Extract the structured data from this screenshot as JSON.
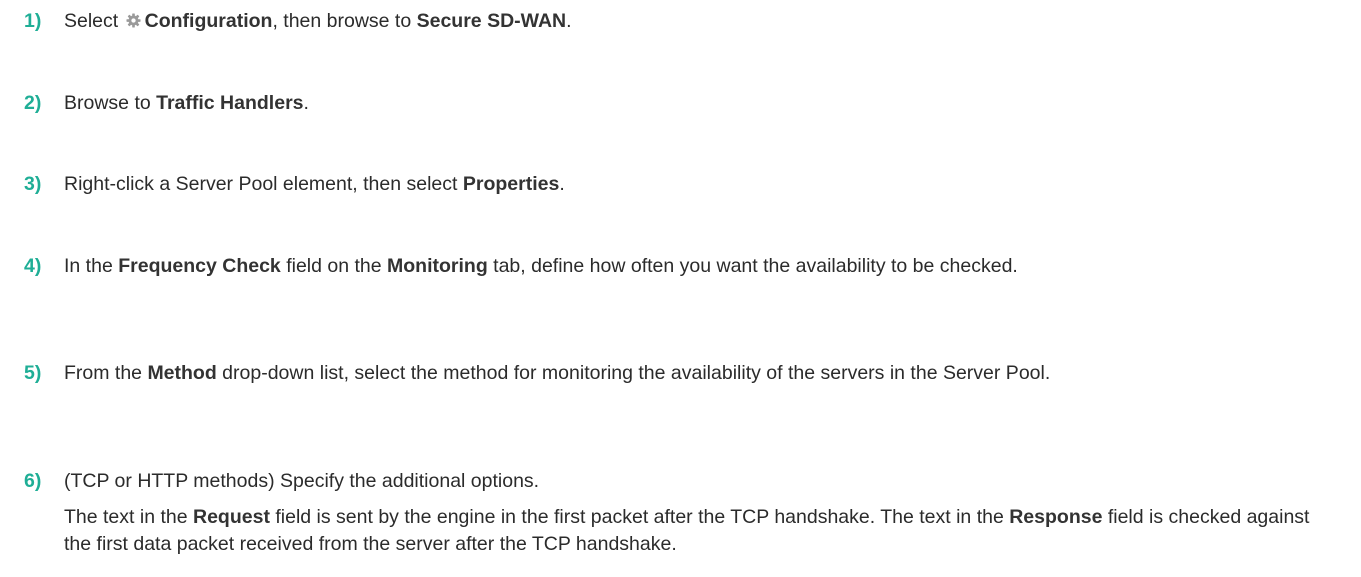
{
  "steps": [
    {
      "number": "1)",
      "parts": [
        {
          "t": "Select "
        },
        {
          "icon": "gear-icon"
        },
        {
          "t": "Configuration",
          "b": true
        },
        {
          "t": ", then browse to "
        },
        {
          "t": "Secure SD-WAN",
          "b": true
        },
        {
          "t": "."
        }
      ]
    },
    {
      "number": "2)",
      "parts": [
        {
          "t": "Browse to "
        },
        {
          "t": "Traffic Handlers",
          "b": true
        },
        {
          "t": "."
        }
      ]
    },
    {
      "number": "3)",
      "parts": [
        {
          "t": "Right-click a Server Pool element, then select "
        },
        {
          "t": "Properties",
          "b": true
        },
        {
          "t": "."
        }
      ]
    },
    {
      "number": "4)",
      "parts": [
        {
          "t": "In the "
        },
        {
          "t": "Frequency Check",
          "b": true
        },
        {
          "t": " field on the "
        },
        {
          "t": "Monitoring",
          "b": true
        },
        {
          "t": " tab, define how often you want the availability to be checked."
        }
      ]
    },
    {
      "number": "5)",
      "parts": [
        {
          "t": "From the "
        },
        {
          "t": "Method",
          "b": true
        },
        {
          "t": " drop-down list, select the method for monitoring the availability of the servers in the Server Pool."
        }
      ]
    },
    {
      "number": "6)",
      "parts": [
        {
          "t": "(TCP or HTTP methods) Specify the additional options."
        }
      ],
      "extra_parts": [
        {
          "t": "The text in the "
        },
        {
          "t": "Request",
          "b": true
        },
        {
          "t": " field is sent by the engine in the first packet after the TCP handshake. The text in the "
        },
        {
          "t": "Response",
          "b": true
        },
        {
          "t": " field is checked against the first data packet received from the server after the TCP handshake."
        }
      ]
    }
  ]
}
